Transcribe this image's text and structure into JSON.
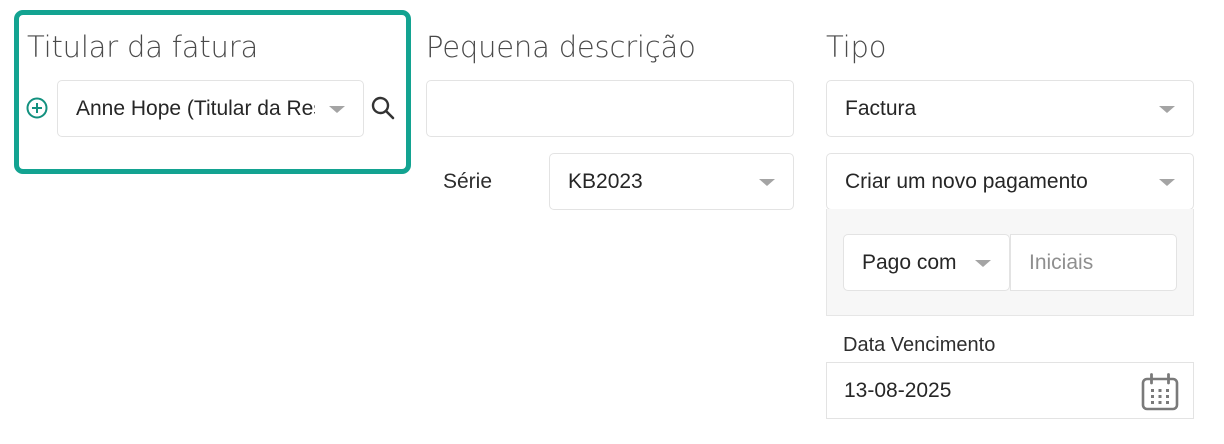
{
  "invoice_holder": {
    "title": "Titular da fatura",
    "selected_holder": "Anne Hope (Titular da Reserva)",
    "add_icon": "plus-circle-icon",
    "search_icon": "search-icon"
  },
  "description": {
    "title": "Pequena descrição",
    "value": ""
  },
  "series": {
    "label": "Série",
    "value": "KB2023"
  },
  "type": {
    "title": "Tipo",
    "value": "Factura"
  },
  "payment": {
    "option": "Criar um novo pagamento",
    "paid_with": "Pago com",
    "initials_placeholder": "Iniciais"
  },
  "due_date": {
    "label": "Data Vencimento",
    "value": "13-08-2025",
    "icon": "calendar-icon"
  },
  "colors": {
    "accent": "#13a391",
    "border": "#e3e3e3",
    "caret": "#a4a4a4",
    "panel_bg": "#f7f7f7"
  }
}
